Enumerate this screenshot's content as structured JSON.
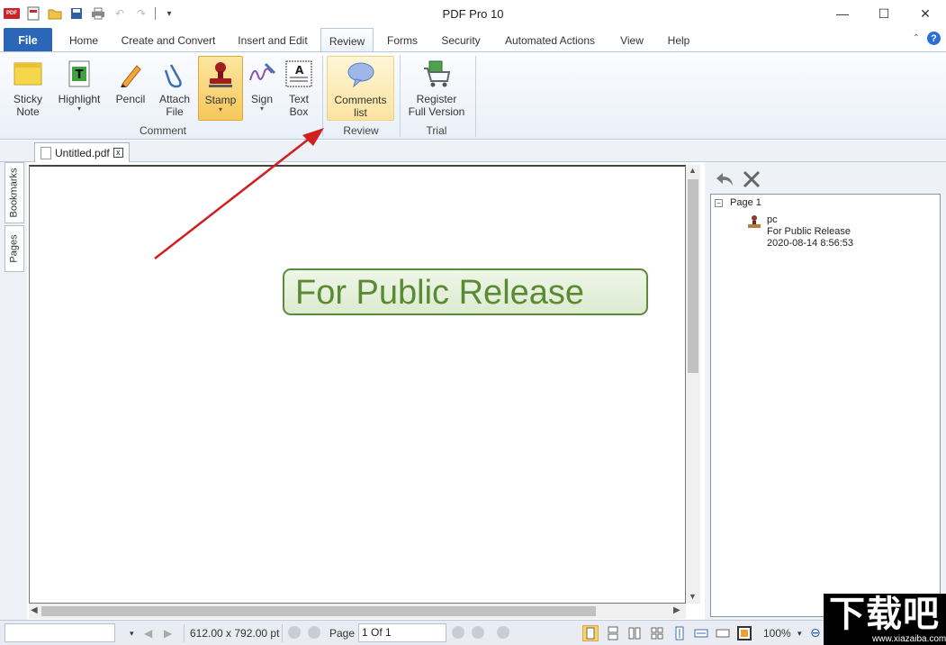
{
  "window": {
    "title": "PDF Pro 10",
    "app_logo_text": "PDF"
  },
  "ribbon_tabs": [
    "File",
    "Home",
    "Create and Convert",
    "Insert and Edit",
    "Review",
    "Forms",
    "Security",
    "Automated Actions",
    "View",
    "Help"
  ],
  "active_tab": "Review",
  "help_label": "?",
  "ribbon": {
    "buttons": [
      {
        "line1": "Sticky",
        "line2": "Note",
        "icon": "sticky-note-icon"
      },
      {
        "line1": "Highlight",
        "line2": "▾",
        "icon": "highlight-icon"
      },
      {
        "line1": "Pencil",
        "line2": "",
        "icon": "pencil-icon"
      },
      {
        "line1": "Attach",
        "line2": "File",
        "icon": "paperclip-icon"
      },
      {
        "line1": "Stamp",
        "line2": "▾",
        "icon": "stamp-icon"
      },
      {
        "line1": "Sign",
        "line2": "▾",
        "icon": "signature-icon"
      },
      {
        "line1": "Text",
        "line2": "Box",
        "icon": "text-box-icon"
      },
      {
        "line1": "Comments",
        "line2": "list",
        "icon": "speech-bubble-icon"
      },
      {
        "line1": "Register",
        "line2": "Full Version",
        "icon": "shopping-cart-icon"
      }
    ],
    "groups": [
      "Comment",
      "Review",
      "Trial"
    ],
    "highlight_glyph": "T",
    "textbox_glyph": "A"
  },
  "document": {
    "tab_title": "Untitled.pdf",
    "tab_close": "x",
    "stamp_text": "For Public Release"
  },
  "side_tabs": [
    "Bookmarks",
    "Pages"
  ],
  "comments_panel": {
    "page_label": "Page 1",
    "expander": "−",
    "comment": {
      "author": "pc",
      "text": "For Public Release",
      "timestamp": "2020-08-14 8:56:53"
    }
  },
  "statusbar": {
    "page_size": "612.00 x 792.00 pt",
    "page_label": "Page",
    "page_value": "1 Of 1",
    "zoom": "100%"
  },
  "watermark": {
    "big": "下载吧",
    "small": "www.xiazaiba.com"
  },
  "colors": {
    "file_tab": "#2c66b8",
    "pressed_button": "#f7c75a",
    "stamp_green": "#5a8a34",
    "annotation_arrow": "#d01f1f"
  }
}
